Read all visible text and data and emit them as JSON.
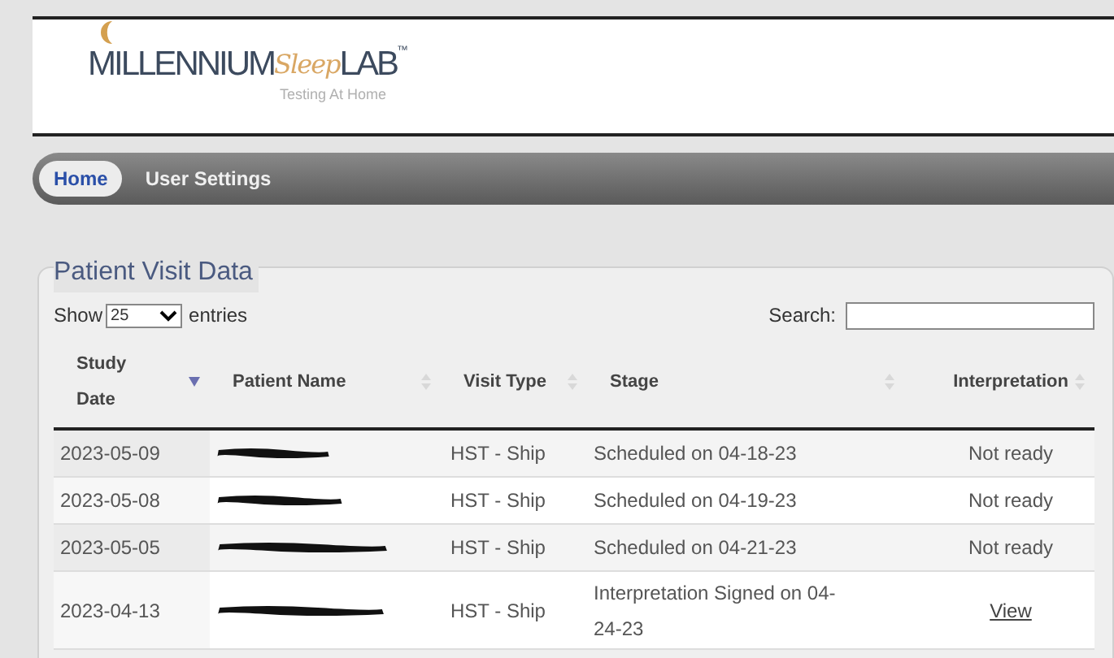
{
  "logo": {
    "word_1": "MILLENNIUM",
    "word_2": "Sleep",
    "word_3": "LAB",
    "mark": "™",
    "tagline": "Testing At Home"
  },
  "nav": {
    "items": [
      {
        "label": "Home",
        "selected": true
      },
      {
        "label": "User Settings",
        "selected": false
      }
    ]
  },
  "panel": {
    "title": "Patient Visit Data",
    "show_label": "Show",
    "page_size": "25",
    "entries_label": "entries",
    "search_label": "Search:",
    "table": {
      "columns": [
        {
          "label": "Study Date",
          "sorted": true
        },
        {
          "label": "Patient Name",
          "sorted": false
        },
        {
          "label": "Visit Type",
          "sorted": false
        },
        {
          "label": "Stage",
          "sorted": false
        },
        {
          "label": "Interpretation",
          "sorted": false
        }
      ],
      "rows": [
        {
          "study_date": "2023-05-09",
          "patient_name": {
            "kind": "redacted"
          },
          "visit_type": "HST - Ship",
          "stage": "Scheduled on 04-18-23",
          "interpretation": {
            "kind": "text",
            "text": "Not ready"
          }
        },
        {
          "study_date": "2023-05-08",
          "patient_name": {
            "kind": "redacted"
          },
          "visit_type": "HST - Ship",
          "stage": "Scheduled on 04-19-23",
          "interpretation": {
            "kind": "text",
            "text": "Not ready"
          }
        },
        {
          "study_date": "2023-05-05",
          "patient_name": {
            "kind": "redacted"
          },
          "visit_type": "HST - Ship",
          "stage": "Scheduled on 04-21-23",
          "interpretation": {
            "kind": "text",
            "text": "Not ready"
          }
        },
        {
          "study_date": "2023-04-13",
          "patient_name": {
            "kind": "redacted"
          },
          "visit_type": "HST - Ship",
          "stage": "Interpretation Signed on 04-24-23",
          "interpretation": {
            "kind": "link",
            "text": "View"
          }
        }
      ]
    }
  }
}
